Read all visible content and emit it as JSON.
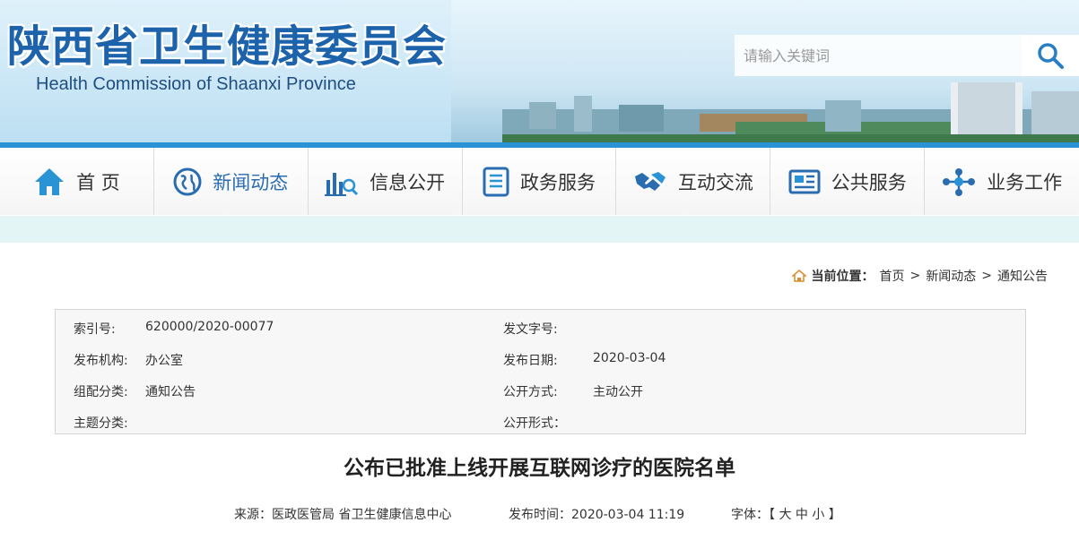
{
  "header": {
    "title": "陕西省卫生健康委员会",
    "subtitle": "Health Commission of Shaanxi Province",
    "search_placeholder": "请输入关键词"
  },
  "nav": {
    "items": [
      {
        "label": "首 页",
        "icon": "home-icon"
      },
      {
        "label": "新闻动态",
        "icon": "globe-icon"
      },
      {
        "label": "信息公开",
        "icon": "chart-search-icon"
      },
      {
        "label": "政务服务",
        "icon": "document-list-icon"
      },
      {
        "label": "互动交流",
        "icon": "handshake-icon"
      },
      {
        "label": "公共服务",
        "icon": "newspaper-icon"
      },
      {
        "label": "业务工作",
        "icon": "network-icon"
      }
    ],
    "accent": "#2a93d6"
  },
  "breadcrumb": {
    "label": "当前位置：",
    "home": "首页",
    "sep1": ">",
    "section": "新闻动态",
    "sep2": ">",
    "current": "通知公告"
  },
  "meta": {
    "index_label": "索引号:",
    "index_value": "620000/2020-00077",
    "doc_no_label": "发文字号:",
    "doc_no_value": "",
    "org_label": "发布机构:",
    "org_value": "办公室",
    "date_label": "发布日期:",
    "date_value": "2020-03-04",
    "category_label": "组配分类:",
    "category_value": "通知公告",
    "open_mode_label": "公开方式:",
    "open_mode_value": "主动公开",
    "topic_label": "主题分类:",
    "topic_value": "",
    "open_form_label": "公开形式：",
    "open_form_value": ""
  },
  "article": {
    "title": "公布已批准上线开展互联网诊疗的医院名单",
    "source": "来源：医政医管局 省卫生健康信息中心",
    "time": "发布时间：2020-03-04 11:19",
    "font_label": "字体：【 大 中 小 】"
  }
}
